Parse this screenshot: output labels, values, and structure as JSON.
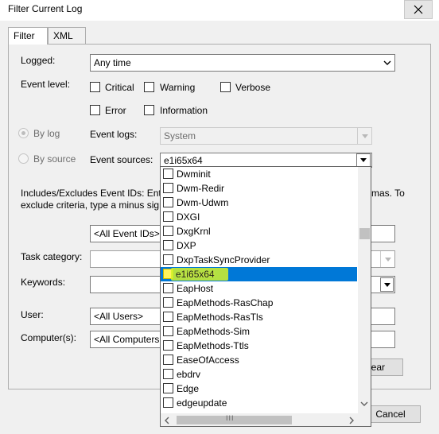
{
  "window": {
    "title": "Filter Current Log"
  },
  "tabs": [
    {
      "label": "Filter",
      "active": true
    },
    {
      "label": "XML",
      "active": false
    }
  ],
  "filter": {
    "logged": {
      "label": "Logged:",
      "value": "Any time"
    },
    "event_level": {
      "label": "Event level:",
      "options": [
        "Critical",
        "Warning",
        "Verbose",
        "Error",
        "Information"
      ]
    },
    "by_log": {
      "label": "By log",
      "checked": true
    },
    "by_source": {
      "label": "By source",
      "checked": false
    },
    "event_logs": {
      "label": "Event logs:",
      "value": "System"
    },
    "event_sources": {
      "label": "Event sources:",
      "value": "e1i65x64"
    },
    "event_ids_help": {
      "line1": "Includes/Excludes Event IDs: Ente",
      "line1_end": "mas. To",
      "line2": "exclude criteria, type a minus sign"
    },
    "event_ids_value": "<All Event IDs>",
    "task_category": {
      "label": "Task category:"
    },
    "keywords": {
      "label": "Keywords:"
    },
    "user": {
      "label": "User:",
      "value": "<All Users>"
    },
    "computers": {
      "label": "Computer(s):",
      "value": "<All Computers"
    },
    "clear_button": "ear",
    "cancel_button": "Cancel"
  },
  "source_list": {
    "items": [
      "Dwminit",
      "Dwm-Redir",
      "Dwm-Udwm",
      "DXGI",
      "DxgKrnl",
      "DXP",
      "DxpTaskSyncProvider",
      "e1i65x64",
      "EapHost",
      "EapMethods-RasChap",
      "EapMethods-RasTls",
      "EapMethods-Sim",
      "EapMethods-Ttls",
      "EaseOfAccess",
      "ebdrv",
      "Edge",
      "edgeupdate"
    ],
    "selected": "e1i65x64",
    "hscroll_grip": "III"
  },
  "colors": {
    "selection": "#0078d7",
    "highlight_marker": "#d4f228"
  }
}
